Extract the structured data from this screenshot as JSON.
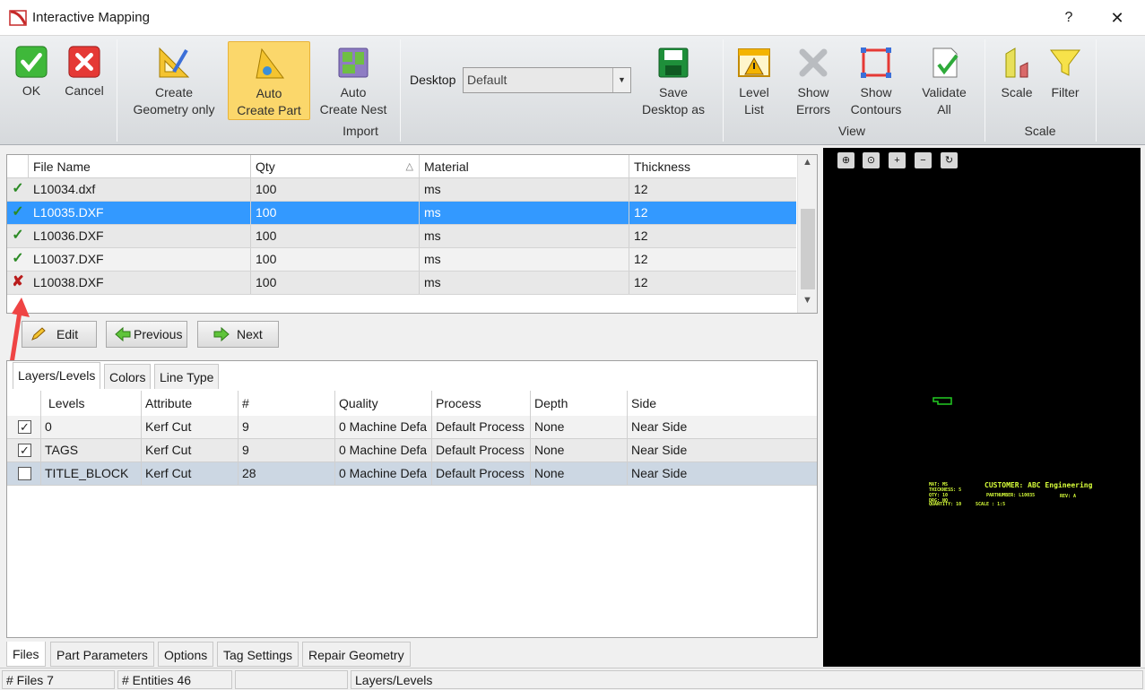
{
  "window": {
    "title": "Interactive Mapping",
    "help": "?",
    "close": "✕"
  },
  "ribbon": {
    "ok": "OK",
    "cancel": "Cancel",
    "create_geometry_1": "Create",
    "create_geometry_2": "Geometry only",
    "auto_part_1": "Auto",
    "auto_part_2": "Create Part",
    "auto_nest_1": "Auto",
    "auto_nest_2": "Create Nest",
    "import_group": "Import",
    "desktop_label": "Desktop",
    "desktop_value": "Default",
    "save_desktop_1": "Save",
    "save_desktop_2": "Desktop as",
    "level_list_1": "Level",
    "level_list_2": "List",
    "show_errors_1": "Show",
    "show_errors_2": "Errors",
    "show_contours_1": "Show",
    "show_contours_2": "Contours",
    "validate_all_1": "Validate",
    "validate_all_2": "All",
    "view_group": "View",
    "scale": "Scale",
    "filter": "Filter",
    "scale_group": "Scale"
  },
  "files_table": {
    "headers": {
      "file_name": "File Name",
      "qty": "Qty",
      "sort_icon": "△",
      "material": "Material",
      "thickness": "Thickness"
    },
    "rows": [
      {
        "status": "ok",
        "mark": "✓",
        "file": "L10034.dxf",
        "qty": "100",
        "material": "ms",
        "thickness": "12"
      },
      {
        "status": "ok",
        "mark": "✓",
        "file": "L10035.DXF",
        "qty": "100",
        "material": "ms",
        "thickness": "12"
      },
      {
        "status": "ok",
        "mark": "✓",
        "file": "L10036.DXF",
        "qty": "100",
        "material": "ms",
        "thickness": "12"
      },
      {
        "status": "ok",
        "mark": "✓",
        "file": "L10037.DXF",
        "qty": "100",
        "material": "ms",
        "thickness": "12"
      },
      {
        "status": "error",
        "mark": "✘",
        "file": "L10038.DXF",
        "qty": "100",
        "material": "ms",
        "thickness": "12"
      }
    ]
  },
  "nav_buttons": {
    "edit": "Edit",
    "previous": "Previous",
    "next": "Next"
  },
  "layer_tabs": {
    "layers": "Layers/Levels",
    "colors": "Colors",
    "line_type": "Line Type"
  },
  "layers_table": {
    "headers": {
      "levels": "Levels",
      "attribute": "Attribute",
      "count": "#",
      "quality": "Quality",
      "process": "Process",
      "depth": "Depth",
      "side": "Side"
    },
    "rows": [
      {
        "checked": "✓",
        "level": "0",
        "attribute": "Kerf Cut",
        "count": "9",
        "quality": "0 Machine Defa",
        "process": "Default Process",
        "depth": "None",
        "side": "Near Side"
      },
      {
        "checked": "✓",
        "level": "TAGS",
        "attribute": "Kerf Cut",
        "count": "9",
        "quality": "0 Machine Defa",
        "process": "Default Process",
        "depth": "None",
        "side": "Near Side"
      },
      {
        "checked": "",
        "level": "TITLE_BLOCK",
        "attribute": "Kerf Cut",
        "count": "28",
        "quality": "0 Machine Defa",
        "process": "Default Process",
        "depth": "None",
        "side": "Near Side"
      }
    ]
  },
  "bottom_tabs": {
    "files": "Files",
    "part_parameters": "Part Parameters",
    "options": "Options",
    "tag_settings": "Tag Settings",
    "repair_geometry": "Repair Geometry"
  },
  "status_bar": {
    "files": "# Files 7",
    "entities": "# Entities 46",
    "empty": "",
    "mode": "Layers/Levels"
  },
  "preview": {
    "customer": "CUSTOMER: ABC Engineering",
    "line1": "MAT: MS",
    "line2": "THICKNESS: 5",
    "line3": "QTY: 10",
    "line4": "DRG: NO",
    "partnumber": "PARTNUMBER: L10035",
    "rev": "REV: A",
    "quantity": "QUANTITY: 10",
    "scale": "SCALE : 1:5"
  },
  "colors": {
    "selected_row": "#3399ff",
    "ok_mark": "#2b8a24",
    "error_mark": "#b91c1c",
    "active_button": "#fbd76b",
    "cad_text": "#d8ff3a",
    "cad_part": "#22cc22"
  }
}
